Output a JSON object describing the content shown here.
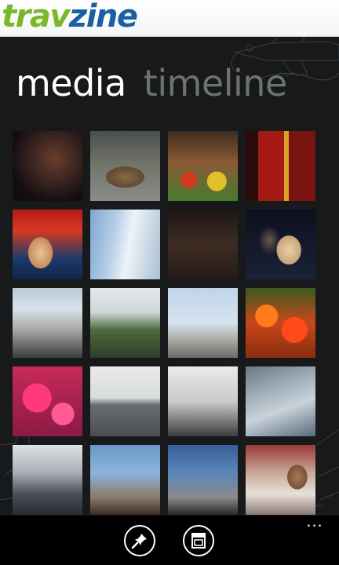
{
  "header": {
    "logo_part1": "trav",
    "logo_part2": "zine"
  },
  "pivot": {
    "items": [
      {
        "label": "media"
      },
      {
        "label": "timeline"
      }
    ]
  },
  "colors": {
    "logo_green": "#79b829",
    "logo_blue": "#1b5fa3",
    "panel_bg": "#17191a",
    "pivot_inactive": "#6e7273"
  },
  "grid": {
    "photos": [
      {
        "name": "photo-dark-ember"
      },
      {
        "name": "photo-bronze-pig"
      },
      {
        "name": "photo-market-stall"
      },
      {
        "name": "photo-circus-poster"
      },
      {
        "name": "photo-carter-poster"
      },
      {
        "name": "photo-glass-building"
      },
      {
        "name": "photo-stone-wall-room"
      },
      {
        "name": "photo-couple-night"
      },
      {
        "name": "photo-public-market-sign"
      },
      {
        "name": "photo-harbor-view"
      },
      {
        "name": "photo-seaplane"
      },
      {
        "name": "photo-orange-flowers"
      },
      {
        "name": "photo-pink-dahlias"
      },
      {
        "name": "photo-ferry-boat"
      },
      {
        "name": "photo-space-needle"
      },
      {
        "name": "photo-aerial-window"
      },
      {
        "name": "photo-city-skyline-dusk"
      },
      {
        "name": "photo-round-towers"
      },
      {
        "name": "photo-tower-closeup"
      },
      {
        "name": "photo-train-portrait"
      }
    ]
  },
  "appbar": {
    "icons": [
      "pin-icon",
      "calendar-icon"
    ],
    "more": "..."
  }
}
